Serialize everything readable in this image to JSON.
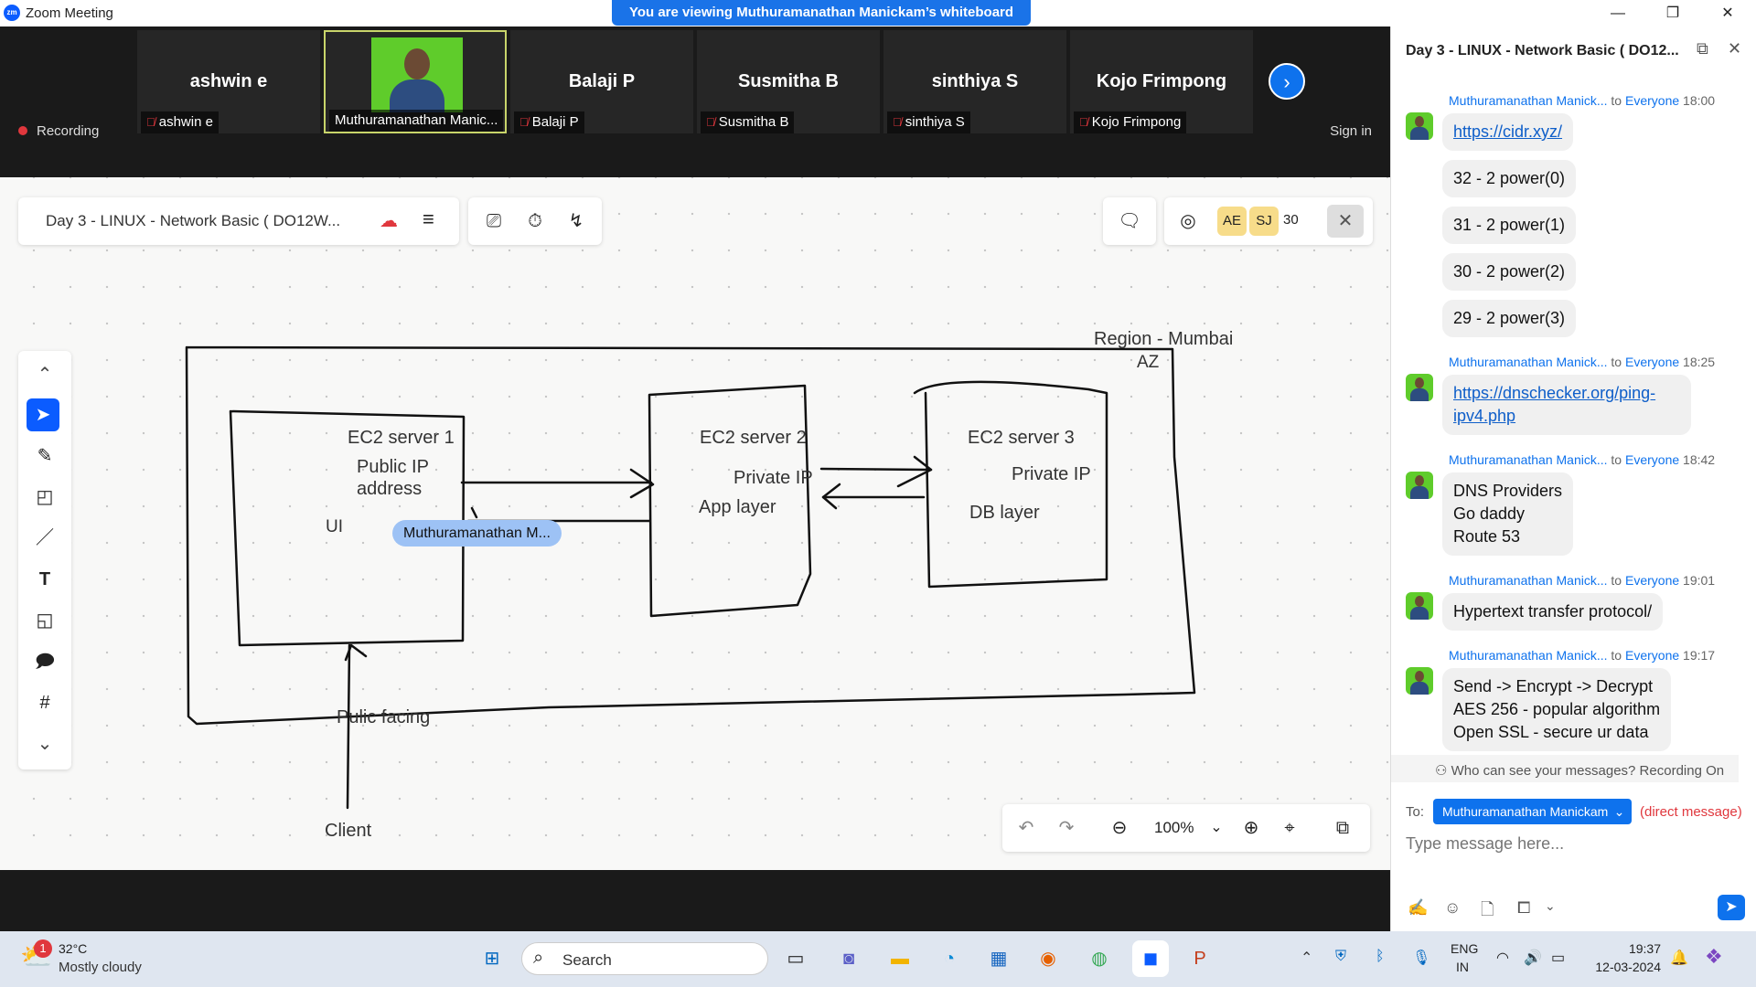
{
  "window": {
    "title": "Zoom Meeting",
    "banner": "You are viewing Muthuramanathan Manickam’s whiteboard"
  },
  "participants": [
    {
      "name": "ashwin e",
      "label": "ashwin e",
      "muted": true
    },
    {
      "name": "",
      "label": "Muthuramanathan Manic...",
      "muted": false,
      "video": true
    },
    {
      "name": "Balaji P",
      "label": "Balaji P",
      "muted": true
    },
    {
      "name": "Susmitha B",
      "label": "Susmitha B",
      "muted": true
    },
    {
      "name": "sinthiya S",
      "label": "sinthiya S",
      "muted": true
    },
    {
      "name": "Kojo Frimpong",
      "label": "Kojo Frimpong",
      "muted": true
    }
  ],
  "recording": {
    "label": "Recording"
  },
  "signin": "Sign in",
  "whiteboard": {
    "title": "Day 3  - LINUX - Network Basic ( DO12W...",
    "collaborators": [
      "AE",
      "SJ"
    ],
    "collab_count": "30",
    "zoom": "100%",
    "cursor_label": "Muthuramanathan M...",
    "drawing": {
      "region": "Region - Mumbai",
      "az": "AZ",
      "server1_title": "EC2 server 1",
      "server1_line1": "Public IP",
      "server1_line2": "address",
      "server1_ui": "UI",
      "server2_title": "EC2 server 2",
      "server2_ip": "Private IP",
      "server2_layer": "App layer",
      "server3_title": "EC2 server 3",
      "server3_ip": "Private IP",
      "server3_layer": "DB layer",
      "public_facing": "Pulic facing",
      "client": "Client"
    }
  },
  "chat": {
    "title": "Day 3  - LINUX - Network Basic ( DO12...",
    "messages": [
      {
        "sender": "Muthuramanathan Manick...",
        "to": "to",
        "audience": "Everyone",
        "time": "18:00",
        "bubbles": [
          "https://cidr.xyz/",
          "32 - 2 power(0)",
          "31 - 2 power(1)",
          "30 - 2 power(2)",
          "29 - 2 power(3)"
        ]
      },
      {
        "sender": "Muthuramanathan Manick...",
        "to": "to",
        "audience": "Everyone",
        "time": "18:25",
        "bubbles": [
          "https://dnschecker.org/ping-",
          "ipv4.php"
        ]
      },
      {
        "sender": "Muthuramanathan Manick...",
        "to": "to",
        "audience": "Everyone",
        "time": "18:42",
        "bubbles": [
          "DNS Providers",
          "Go daddy",
          "Route 53"
        ]
      },
      {
        "sender": "Muthuramanathan Manick...",
        "to": "to",
        "audience": "Everyone",
        "time": "19:01",
        "bubbles": [
          "Hypertext transfer protocol/"
        ]
      },
      {
        "sender": "Muthuramanathan Manick...",
        "to": "to",
        "audience": "Everyone",
        "time": "19:17",
        "bubbles": [
          "Send -> Encrypt -> Decrypt",
          "AES 256 - popular algorithm",
          "Open SSL - secure ur data"
        ]
      }
    ],
    "privacy_note": "Who can see your messages? Recording On",
    "to_label": "To:",
    "recipient": "Muthuramanathan Manickam",
    "direct": "(direct message)",
    "placeholder": "Type message here..."
  },
  "taskbar": {
    "weather_temp": "32°C",
    "weather_desc": "Mostly cloudy",
    "weather_badge": "1",
    "search": "Search",
    "lang1": "ENG",
    "lang2": "IN",
    "time": "19:37",
    "date": "12-03-2024"
  }
}
